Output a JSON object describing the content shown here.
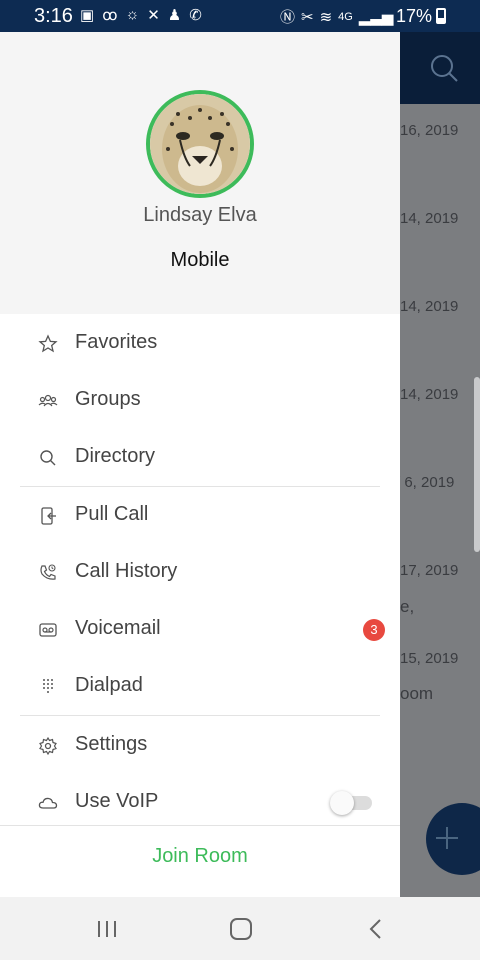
{
  "status_bar": {
    "time": "3:16",
    "network": "4G",
    "battery": "17%"
  },
  "profile": {
    "name": "Lindsay Elva",
    "status": "Mobile",
    "avatar": "cheetah-avatar",
    "ring_color": "#3dbb5a"
  },
  "menu": {
    "favorites": "Favorites",
    "groups": "Groups",
    "directory": "Directory",
    "pull_call": "Pull Call",
    "call_history": "Call History",
    "voicemail": "Voicemail",
    "voicemail_badge": "3",
    "dialpad": "Dialpad",
    "settings": "Settings",
    "use_voip": "Use VoIP",
    "use_voip_enabled": false
  },
  "join_room": "Join Room",
  "background": {
    "dates": [
      "16, 2019",
      "14, 2019",
      "14, 2019",
      "14, 2019",
      "/ 6, 2019",
      "17, 2019",
      "15, 2019"
    ],
    "fragments": [
      "e,",
      "oom"
    ]
  },
  "colors": {
    "accent": "#3dbb5a",
    "badge": "#e8493f",
    "header": "#0a1e39"
  }
}
